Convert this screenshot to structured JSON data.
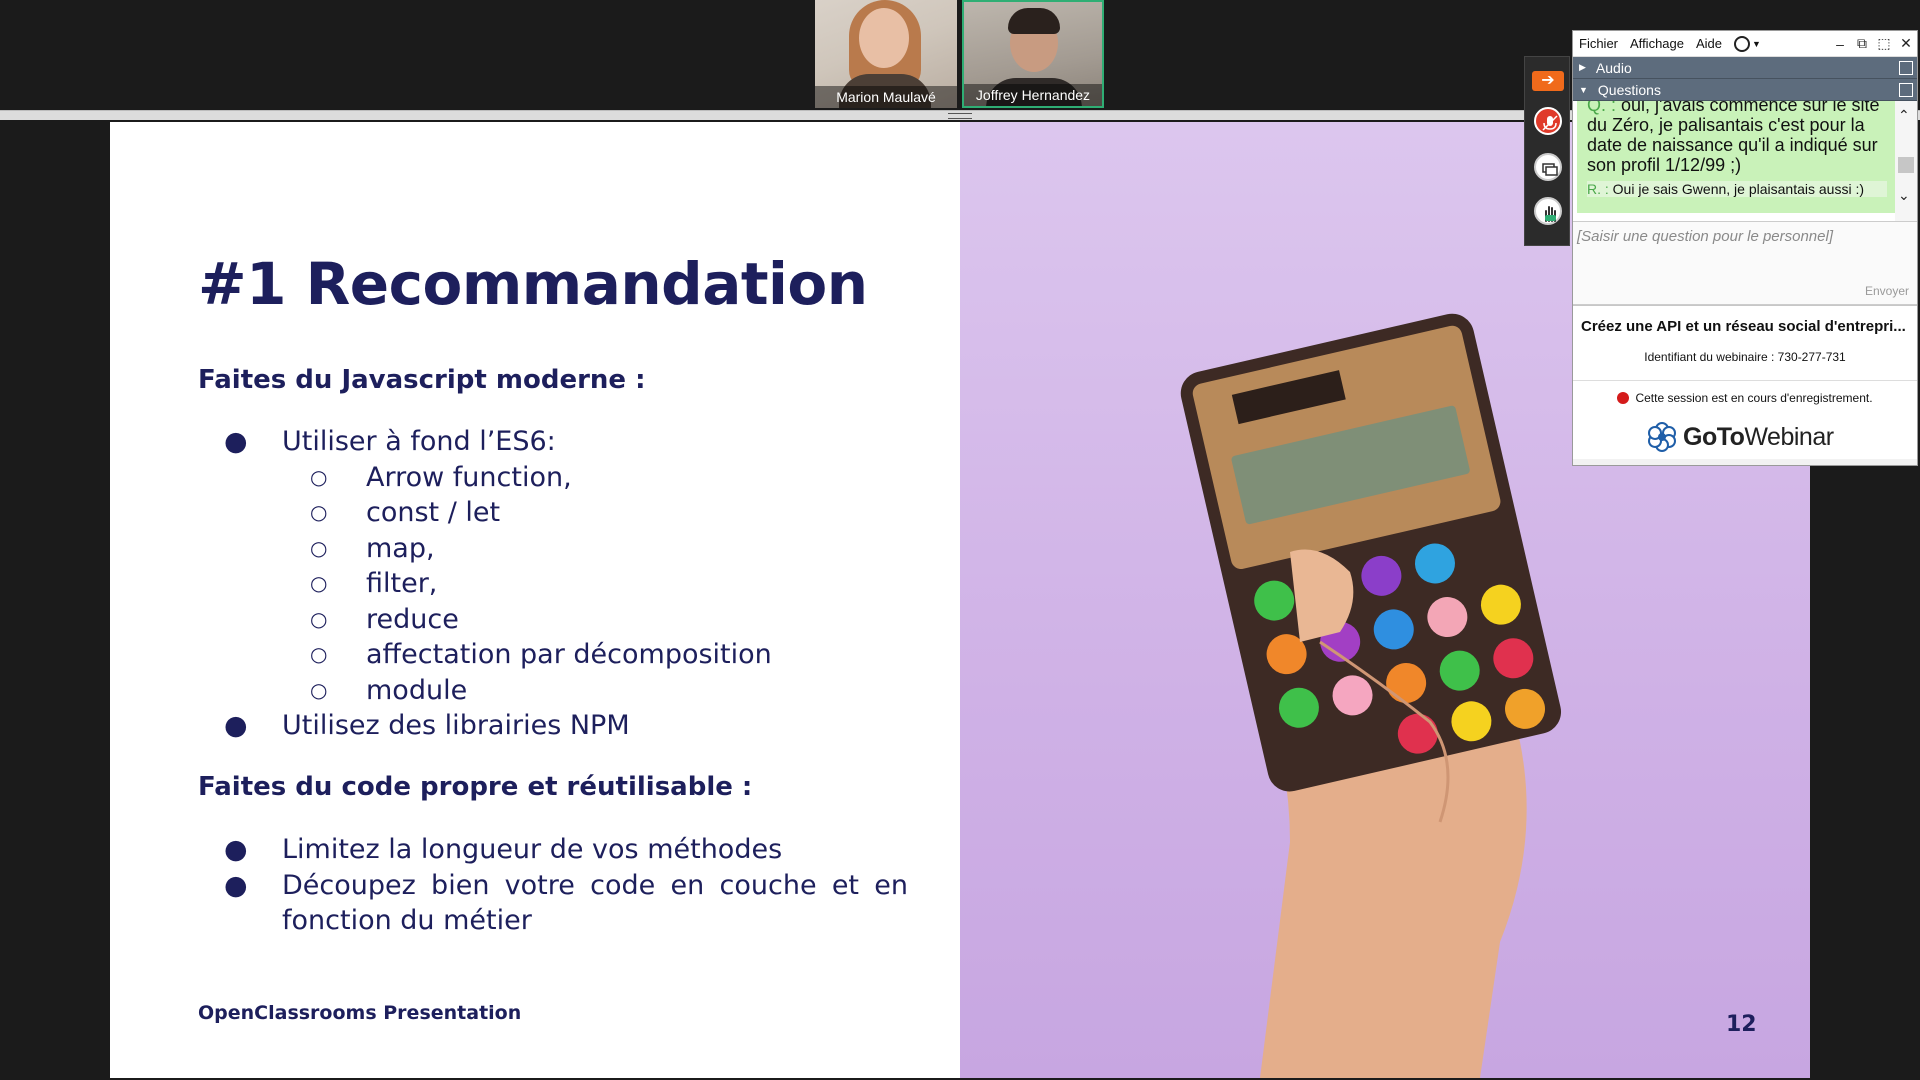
{
  "participants": [
    {
      "name": "Marion Maulavé"
    },
    {
      "name": "Joffrey Hernandez"
    }
  ],
  "slide": {
    "title": "#1 Recommandation",
    "section1_title": "Faites du Javascript moderne :",
    "bullets1": [
      {
        "text": "Utiliser à fond l’ES6:",
        "level": 1
      },
      {
        "text": "Arrow function,",
        "level": 2
      },
      {
        "text": "const / let",
        "level": 2
      },
      {
        "text": "map,",
        "level": 2
      },
      {
        "text": "filter,",
        "level": 2
      },
      {
        "text": "reduce",
        "level": 2
      },
      {
        "text": "affectation par décomposition",
        "level": 2
      },
      {
        "text": "module",
        "level": 2
      },
      {
        "text": "Utilisez des librairies NPM",
        "level": 1
      }
    ],
    "section2_title": "Faites du code propre et réutilisable :",
    "bullets2": [
      {
        "text": "Limitez la longueur de vos méthodes"
      },
      {
        "text": "Découpez bien votre code en couche et en"
      },
      {
        "text": "fonction du métier"
      }
    ],
    "bullet_mark": "●",
    "sub_bullet_mark": "○",
    "footer": "OpenClassrooms Presentation",
    "page_number": "12"
  },
  "goto_panel": {
    "menu": [
      "Fichier",
      "Affichage",
      "Aide"
    ],
    "sections": {
      "audio": "Audio",
      "questions": "Questions"
    },
    "qa": {
      "q_label": "Q. :",
      "question": "oui, j'avais commencé sur le site du Zéro, je palisantais c'est pour la date de naissance qu'il a indiqué sur son profil 1/12/99 ;)",
      "r_label": "R. :",
      "answer": "Oui je sais Gwenn, je plaisantais aussi :)"
    },
    "input_placeholder": "[Saisir une question pour le personnel]",
    "send_label": "Envoyer",
    "webinar_title": "Créez une API et un réseau social d'entrepri...",
    "webinar_id": "Identifiant du webinaire : 730-277-731",
    "recording": "Cette session est en cours d'enregistrement.",
    "brand_bold": "GoTo",
    "brand_light": "Webinar"
  },
  "colors": {
    "slide_text": "#1d1f5c",
    "panel_header": "#5d6c7d",
    "qa_bg": "#c9f2b9",
    "record": "#d41b1b",
    "accent_orange": "#f06a1b"
  }
}
